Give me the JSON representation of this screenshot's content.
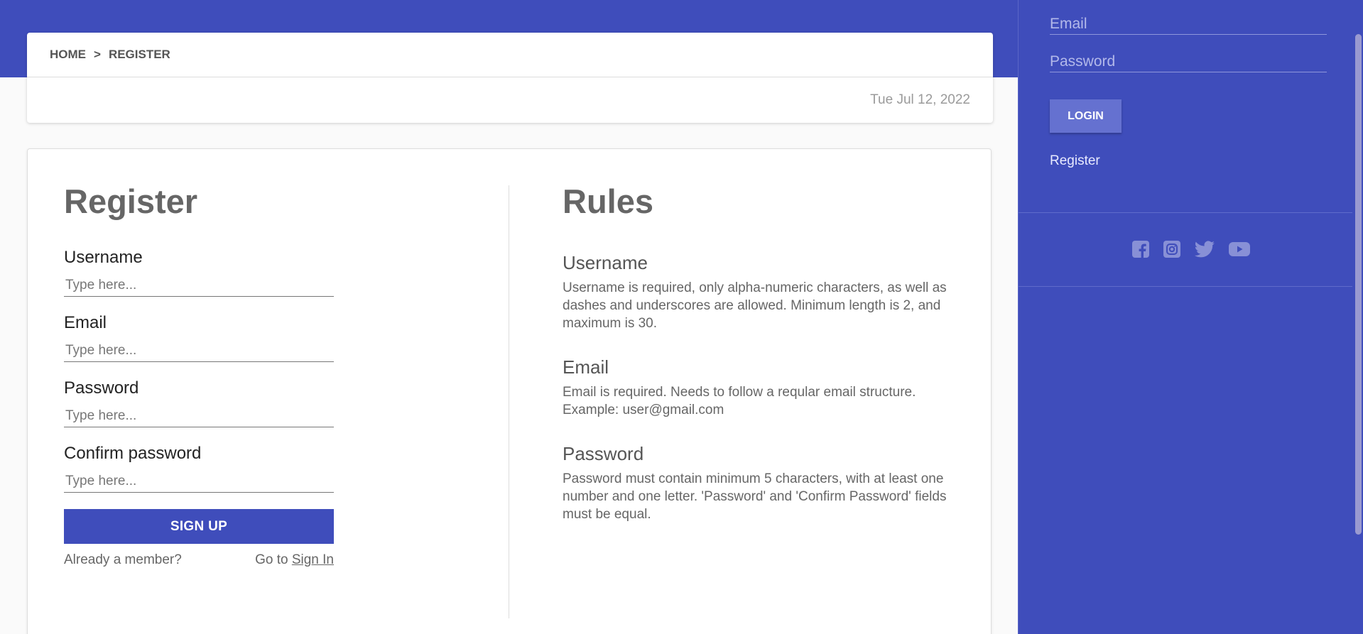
{
  "breadcrumb": {
    "home": "HOME",
    "separator": ">",
    "current": "REGISTER"
  },
  "date": "Tue Jul 12, 2022",
  "register": {
    "title": "Register",
    "fields": [
      {
        "label": "Username",
        "placeholder": "Type here..."
      },
      {
        "label": "Email",
        "placeholder": "Type here..."
      },
      {
        "label": "Password",
        "placeholder": "Type here..."
      },
      {
        "label": "Confirm password",
        "placeholder": "Type here..."
      }
    ],
    "signup_label": "SIGN UP",
    "already_member": "Already a member?",
    "goto_text": "Go to",
    "signin_link": "Sign In"
  },
  "rules": {
    "title": "Rules",
    "items": [
      {
        "title": "Username",
        "text": "Username is required, only alpha-numeric characters, as well as dashes and underscores are allowed. Minimum length is 2, and maximum is 30."
      },
      {
        "title": "Email",
        "text": "Email is required. Needs to follow a reqular email structure. Example: user@gmail.com"
      },
      {
        "title": "Password",
        "text": "Password must contain minimum 5 characters, with at least one number and one letter. 'Password' and 'Confirm Password' fields must be equal."
      }
    ]
  },
  "sidebar": {
    "email_placeholder": "Email",
    "password_placeholder": "Password",
    "login_label": "LOGIN",
    "register_link": "Register",
    "socials": [
      "facebook-icon",
      "instagram-icon",
      "twitter-icon",
      "youtube-icon"
    ]
  },
  "colors": {
    "primary": "#3f4dbb",
    "login_button": "#6571d0",
    "social_icon": "#8890d6"
  }
}
